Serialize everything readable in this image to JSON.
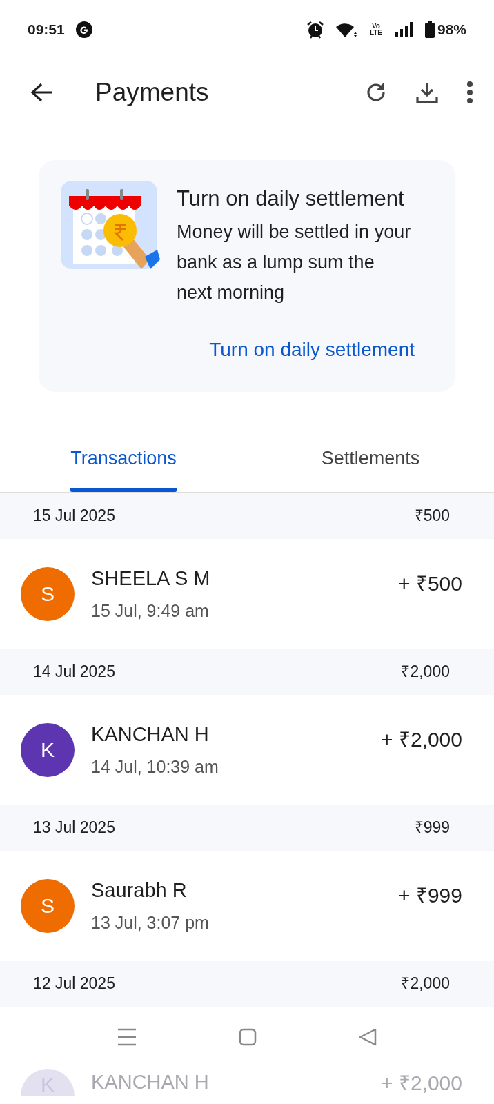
{
  "status_bar": {
    "time": "09:51",
    "network": "Vo LTE",
    "battery": "98%"
  },
  "header": {
    "title": "Payments"
  },
  "promo": {
    "title": "Turn on daily settlement",
    "body": "Money will be settled in your bank as a lump sum the next morning",
    "action": "Turn on daily settlement"
  },
  "tabs": [
    {
      "label": "Transactions",
      "selected": true
    },
    {
      "label": "Settlements",
      "selected": false
    }
  ],
  "groups": [
    {
      "date": "15 Jul 2025",
      "total": "₹500",
      "transactions": [
        {
          "initial": "S",
          "color": "#ef6c00",
          "name": "SHEELA S M",
          "time": "15 Jul, 9:49 am",
          "amount": "+ ₹500",
          "dimmed": false
        }
      ]
    },
    {
      "date": "14 Jul 2025",
      "total": "₹2,000",
      "transactions": [
        {
          "initial": "K",
          "color": "#5e35b1",
          "name": "KANCHAN H",
          "time": "14 Jul, 10:39 am",
          "amount": "+ ₹2,000",
          "dimmed": false
        }
      ]
    },
    {
      "date": "13 Jul 2025",
      "total": "₹999",
      "transactions": [
        {
          "initial": "S",
          "color": "#ef6c00",
          "name": "Saurabh R",
          "time": "13 Jul, 3:07 pm",
          "amount": "+ ₹999",
          "dimmed": false
        }
      ]
    },
    {
      "date": "12 Jul 2025",
      "total": "₹2,000",
      "transactions": [
        {
          "initial": "K",
          "color": "#e3e1f0",
          "name": "KANCHAN H",
          "amount": "+ ₹2,000",
          "dimmed": true
        }
      ]
    }
  ]
}
